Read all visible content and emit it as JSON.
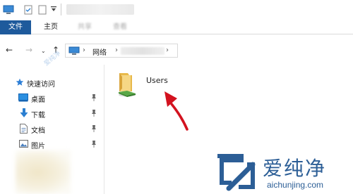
{
  "ribbon": {
    "tabs": [
      {
        "label": "文件",
        "active": true
      },
      {
        "label": "主页",
        "active": false
      },
      {
        "label": "共享",
        "active": false
      },
      {
        "label": "查看",
        "active": false
      }
    ]
  },
  "address": {
    "path": [
      "网络"
    ]
  },
  "navpane": {
    "items": [
      {
        "label": "快速访问",
        "icon": "star-icon",
        "pinned": false
      },
      {
        "label": "桌面",
        "icon": "desktop-folder-icon",
        "pinned": true
      },
      {
        "label": "下载",
        "icon": "download-arrow-icon",
        "pinned": true
      },
      {
        "label": "文档",
        "icon": "document-icon",
        "pinned": true
      },
      {
        "label": "图片",
        "icon": "picture-icon",
        "pinned": true
      }
    ]
  },
  "content": {
    "items": [
      {
        "label": "Users",
        "icon": "shared-folder-icon"
      }
    ]
  },
  "watermark": {
    "brand_name": "爱纯净",
    "brand_url": "aichunjing.com",
    "corner_text": "爱纯净"
  },
  "colors": {
    "file_tab_bg": "#1e5a9c",
    "accent_arrow": "#d3121f",
    "brand": "#2c5e96"
  }
}
